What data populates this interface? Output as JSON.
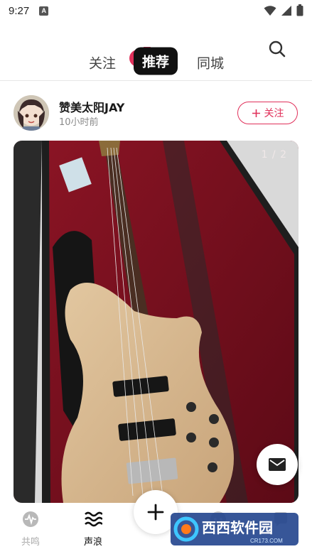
{
  "status_bar": {
    "time": "9:27",
    "app_badge": "A"
  },
  "top_nav": {
    "tabs": [
      {
        "label": "关注"
      },
      {
        "label": "推荐",
        "active": true
      },
      {
        "label": "同城"
      }
    ],
    "accent": "#e0305a"
  },
  "post": {
    "username": "赞美太阳JAY",
    "time": "10小时前",
    "follow_label": "关注",
    "image_counter": "1 / 2"
  },
  "bottom_nav": {
    "items": [
      {
        "label": "共鸣",
        "icon": "gongming-icon"
      },
      {
        "label": "声浪",
        "icon": "wave-icon",
        "active": true
      },
      {
        "label": "",
        "icon": "add-icon"
      },
      {
        "label": "",
        "icon": "message-bubble-icon"
      },
      {
        "label": "",
        "icon": "profile-icon"
      }
    ]
  },
  "watermark": {
    "text": "西西软件园",
    "sub": "CR173.COM"
  }
}
